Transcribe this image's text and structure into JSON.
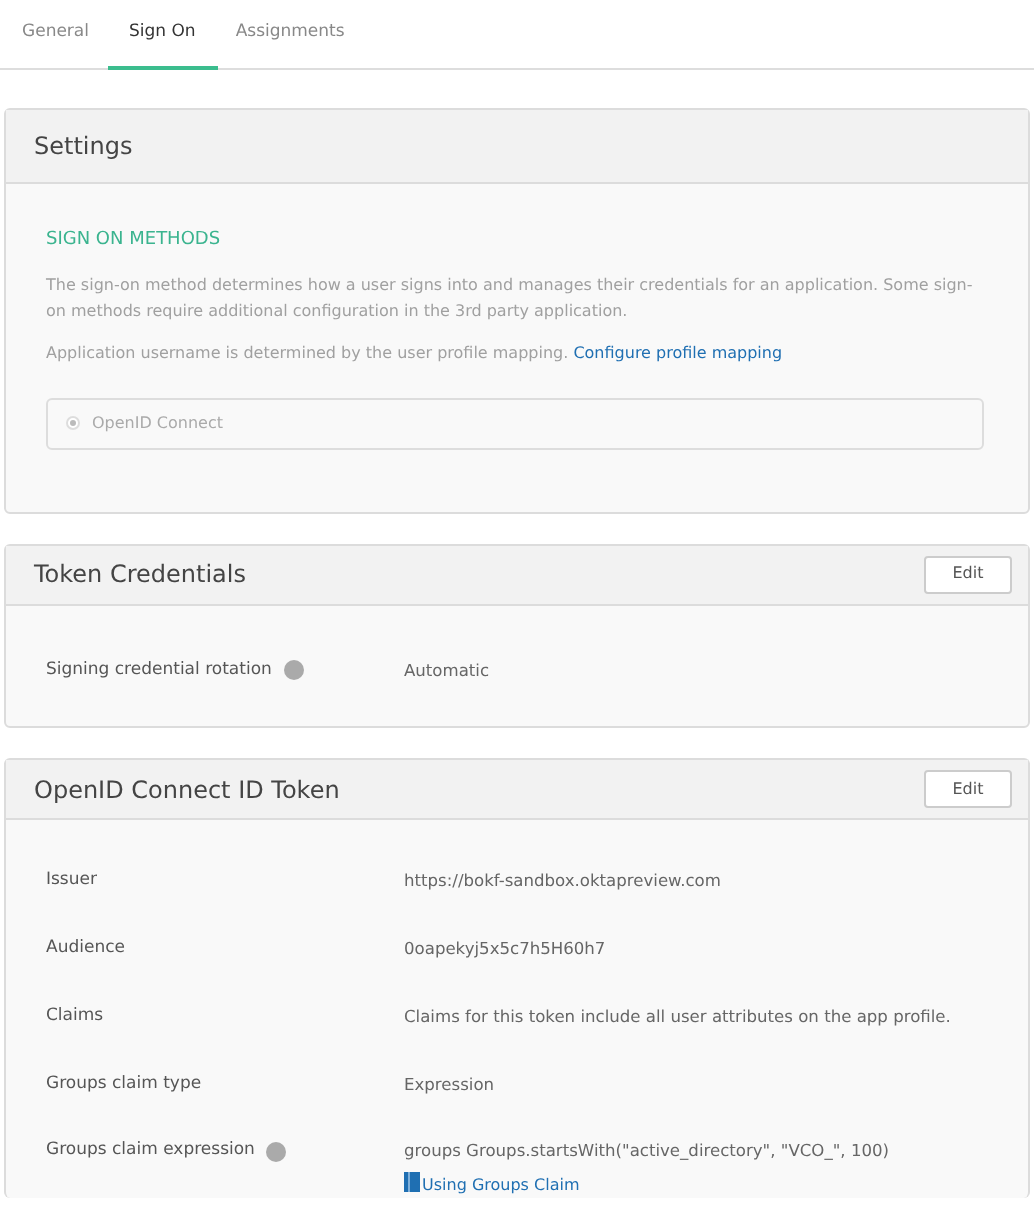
{
  "tabs": [
    {
      "label": "General",
      "selected": false
    },
    {
      "label": "Sign On",
      "selected": true
    },
    {
      "label": "Assignments",
      "selected": false
    }
  ],
  "settings": {
    "title": "Settings",
    "section_heading": "SIGN ON METHODS",
    "description": "The sign-on method determines how a user signs into and manages their credentials for an application. Some sign-on methods require additional configuration in the 3rd party application.",
    "username_note": "Application username is determined by the user profile mapping.",
    "username_link": "Configure profile mapping",
    "methods": [
      {
        "label": "OpenID Connect",
        "selected": true,
        "disabled": true
      }
    ]
  },
  "token_credentials": {
    "title": "Token Credentials",
    "edit_button": "Edit",
    "rows": [
      {
        "label": "Signing credential rotation",
        "help": true,
        "value": "Automatic"
      }
    ]
  },
  "id_token": {
    "title": "OpenID Connect ID Token",
    "edit_button": "Edit",
    "rows": [
      {
        "label": "Issuer",
        "help": false,
        "value": "https://bokf-sandbox.oktapreview.com"
      },
      {
        "label": "Audience",
        "help": false,
        "value": "0oapekyj5x5c7h5H60h7"
      },
      {
        "label": "Claims",
        "help": false,
        "value": "Claims for this token include all user attributes on the app profile."
      },
      {
        "label": "Groups claim type",
        "help": false,
        "value": "Expression"
      },
      {
        "label": "Groups claim expression",
        "help": true,
        "value": "groups   Groups.startsWith(\"active_directory\", \"VCO_\", 100)",
        "link": "Using Groups Claim"
      }
    ]
  }
}
